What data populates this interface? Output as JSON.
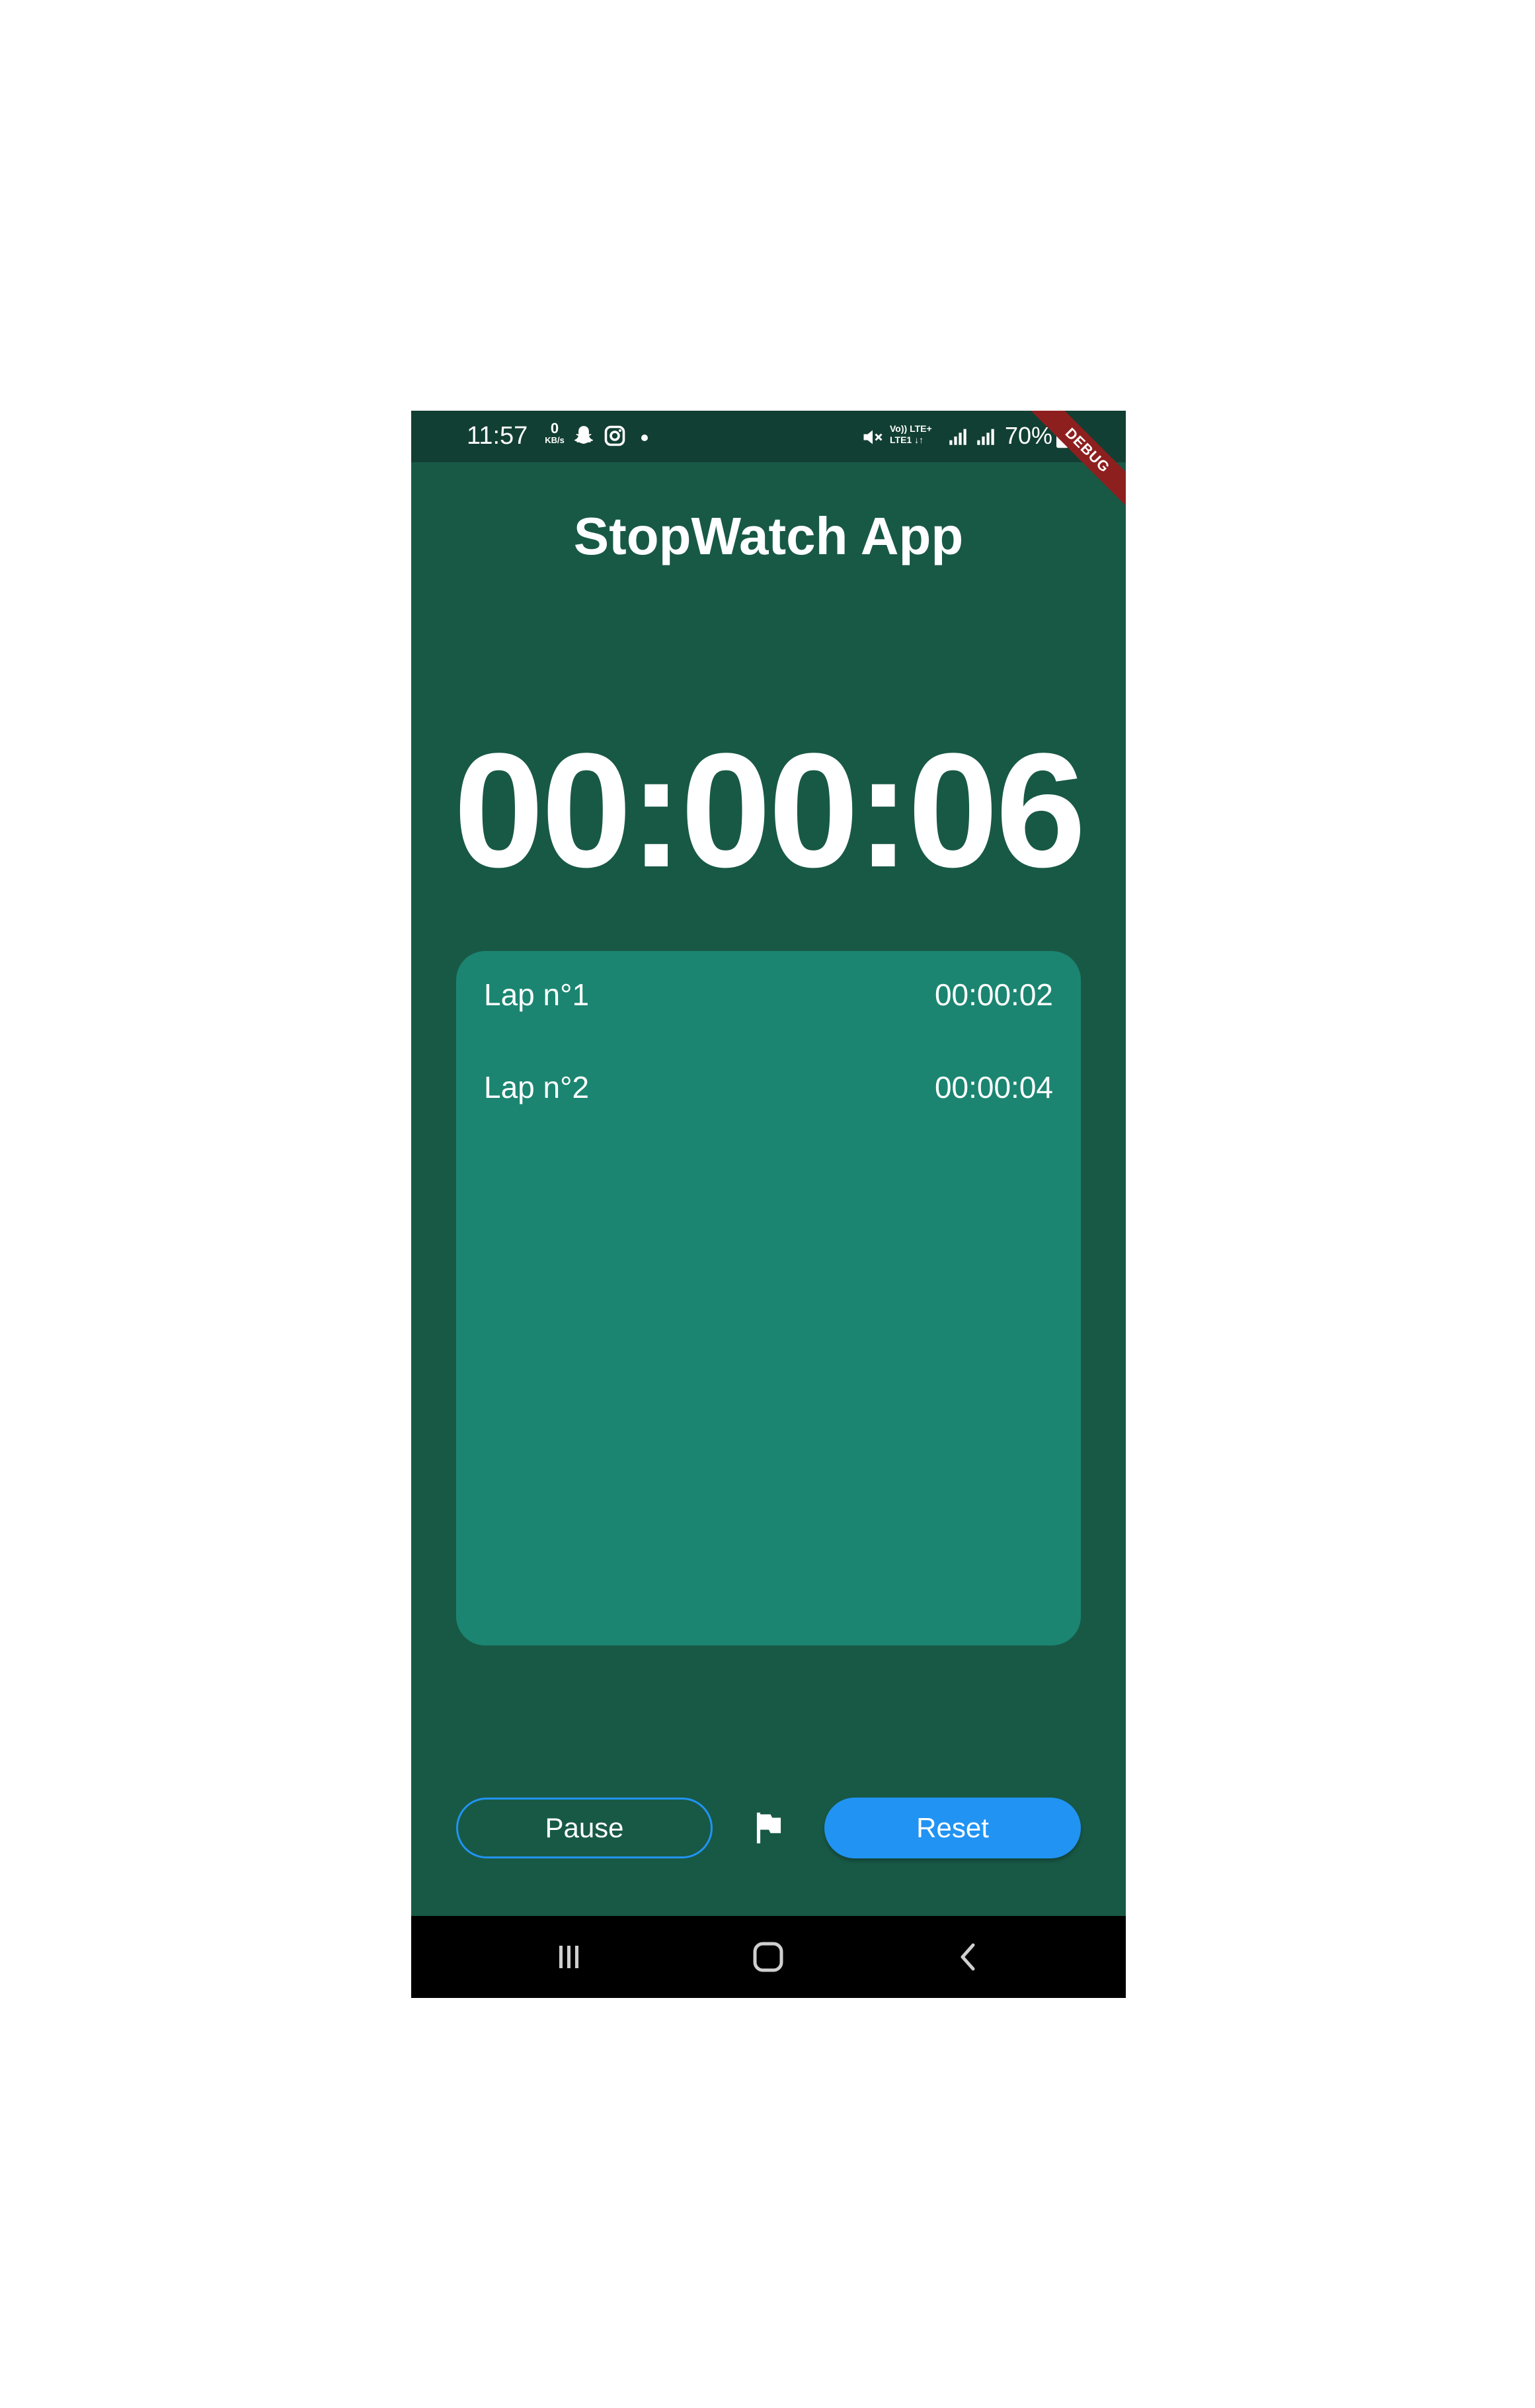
{
  "status_bar": {
    "time": "11:57",
    "data_rate_value": "0",
    "data_rate_unit": "KB/s",
    "network_top": "Vo)) LTE+",
    "network_bottom": "LTE1 ↓↑",
    "battery_percent": "70%",
    "icons": [
      "snapchat-icon",
      "instagram-icon",
      "mute-icon",
      "signal-icon",
      "signal-icon",
      "battery-icon"
    ]
  },
  "debug_banner": "DEBUG",
  "app": {
    "title": "StopWatch App",
    "elapsed_time": "00:00:06"
  },
  "laps": [
    {
      "label": "Lap n°1",
      "time": "00:00:02"
    },
    {
      "label": "Lap n°2",
      "time": "00:00:04"
    }
  ],
  "controls": {
    "pause_label": "Pause",
    "reset_label": "Reset",
    "lap_icon": "flag-icon"
  },
  "colors": {
    "background": "#185946",
    "status_bar": "#123f33",
    "card": "#1b8571",
    "accent": "#2193f3",
    "debug_banner": "#8e1f1f"
  },
  "nav_bar": {
    "icons": [
      "recent-apps-icon",
      "home-icon",
      "back-icon"
    ]
  }
}
